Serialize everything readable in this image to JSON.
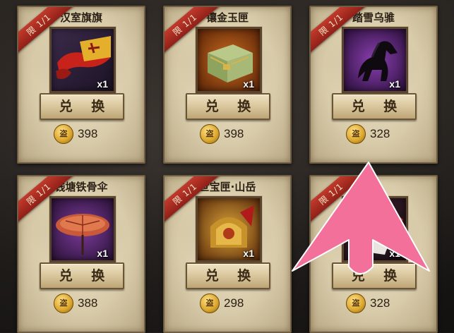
{
  "colors": {
    "arrow": "#f2709a",
    "ribbon": "#b22f24",
    "coin": "#e0a832"
  },
  "cards": [
    {
      "limit": "限 1/1",
      "name": "汉室旗旗",
      "qty": "x1",
      "button": "兑 换",
      "coin": "盗",
      "price": "398",
      "icon": "banner-icon"
    },
    {
      "limit": "限 1/1",
      "name": "镶金玉匣",
      "qty": "x1",
      "button": "兑 换",
      "coin": "盗",
      "price": "398",
      "icon": "jade-box-icon"
    },
    {
      "limit": "限 1/1",
      "name": "踏雪乌骓",
      "qty": "x1",
      "button": "兑 换",
      "coin": "盗",
      "price": "328",
      "icon": "black-horse-icon"
    },
    {
      "limit": "限 1/1",
      "name": "钱塘铁骨伞",
      "qty": "x1",
      "button": "兑 换",
      "coin": "盗",
      "price": "388",
      "icon": "umbrella-icon"
    },
    {
      "limit": "限 1/1",
      "name": "世宝匣·山岳",
      "qty": "x1",
      "button": "兑 换",
      "coin": "盗",
      "price": "298",
      "icon": "treasure-chest-icon"
    },
    {
      "limit": "限 1/1",
      "name": "",
      "qty": "x1",
      "button": "兑 换",
      "coin": "盗",
      "price": "328",
      "icon": "mount-icon"
    }
  ]
}
